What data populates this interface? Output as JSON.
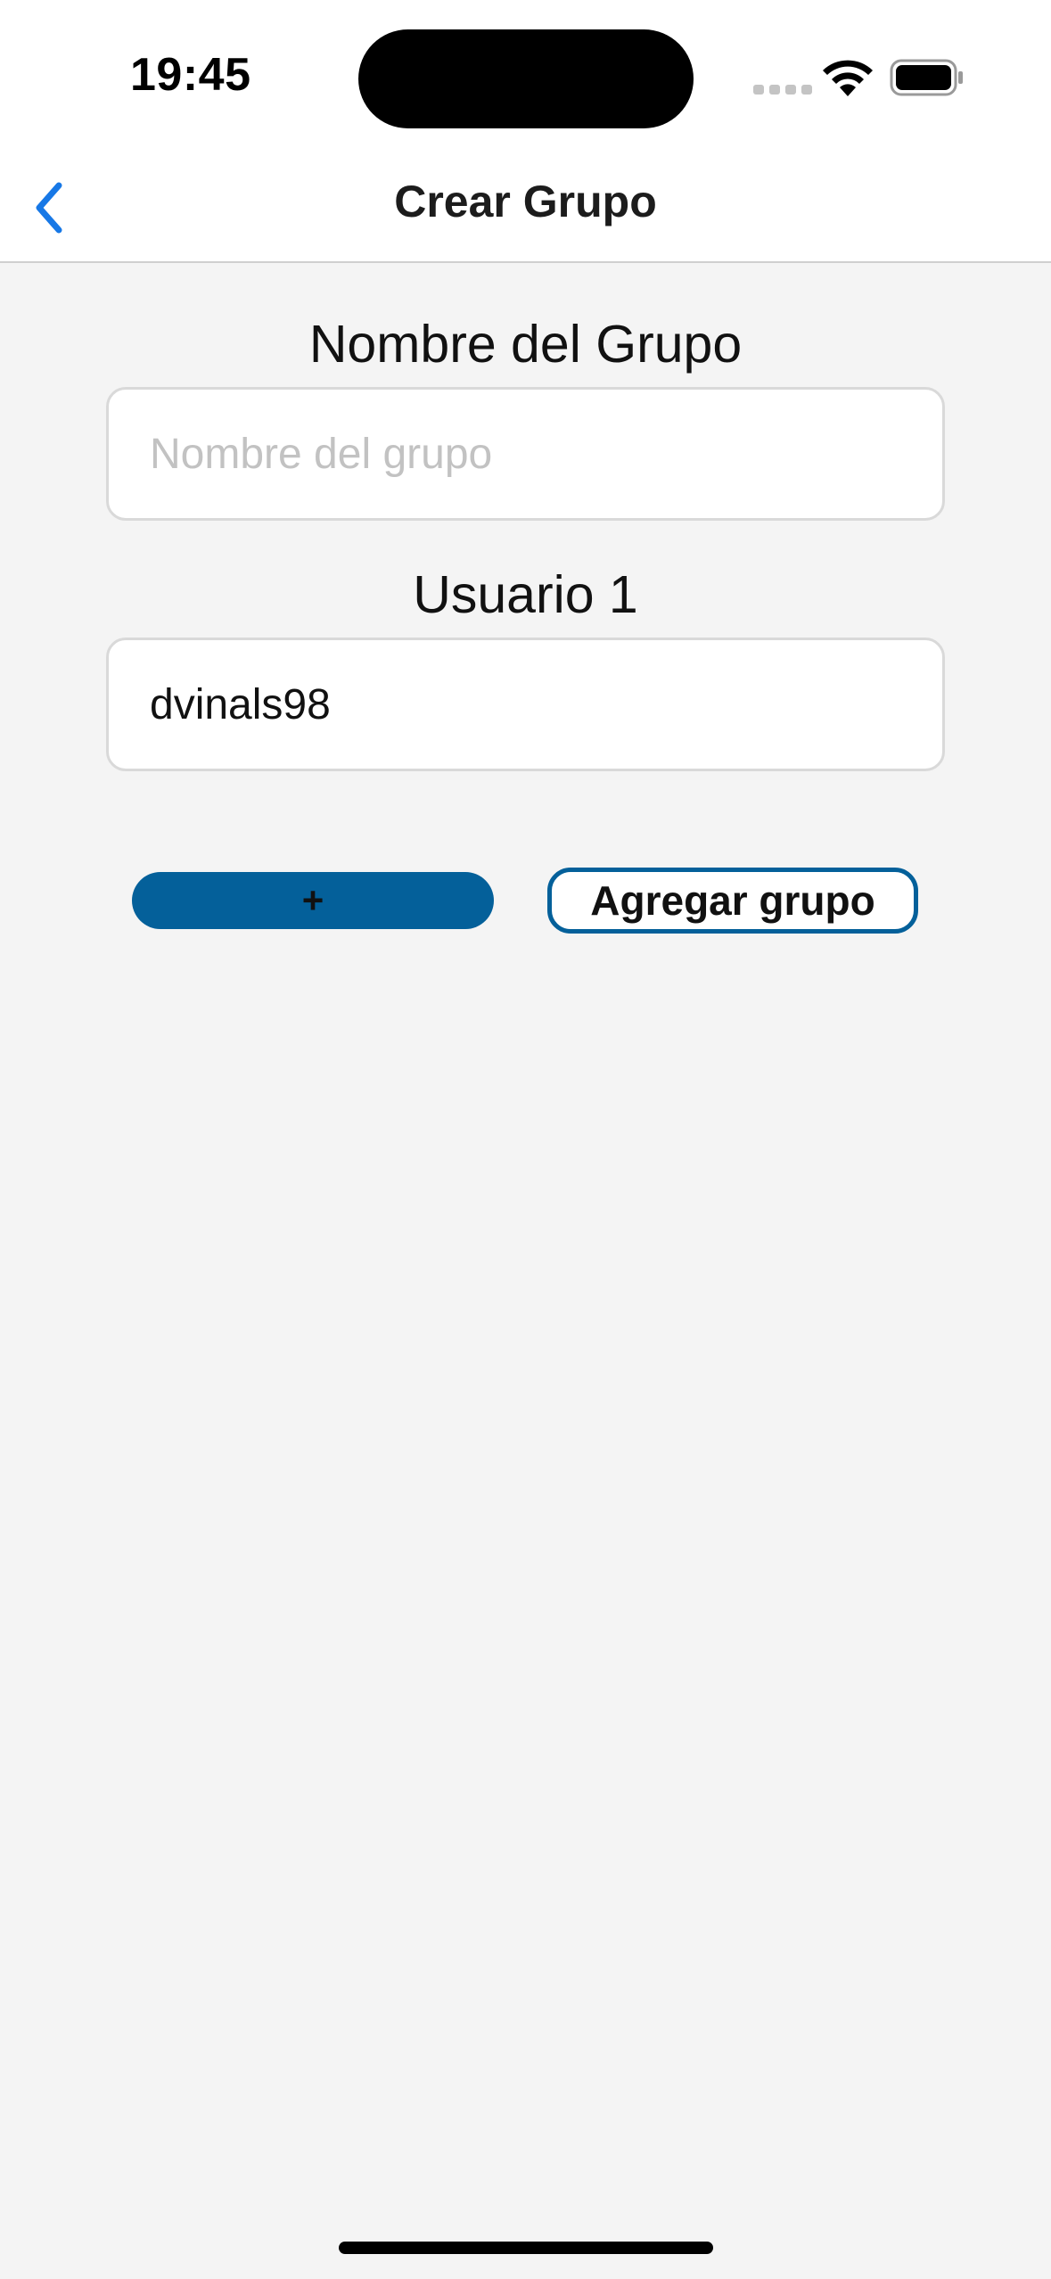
{
  "status_bar": {
    "time": "19:45"
  },
  "nav": {
    "title": "Crear Grupo",
    "back_icon": "chevron-left-icon",
    "accent_color": "#1778e6"
  },
  "form": {
    "group_name_label": "Nombre del Grupo",
    "group_name_placeholder": "Nombre del grupo",
    "group_name_value": "",
    "user_label": "Usuario 1",
    "user_value": "dvinals98"
  },
  "actions": {
    "add_user_label": "+",
    "add_group_label": "Agregar grupo",
    "primary_color": "#04609a"
  }
}
